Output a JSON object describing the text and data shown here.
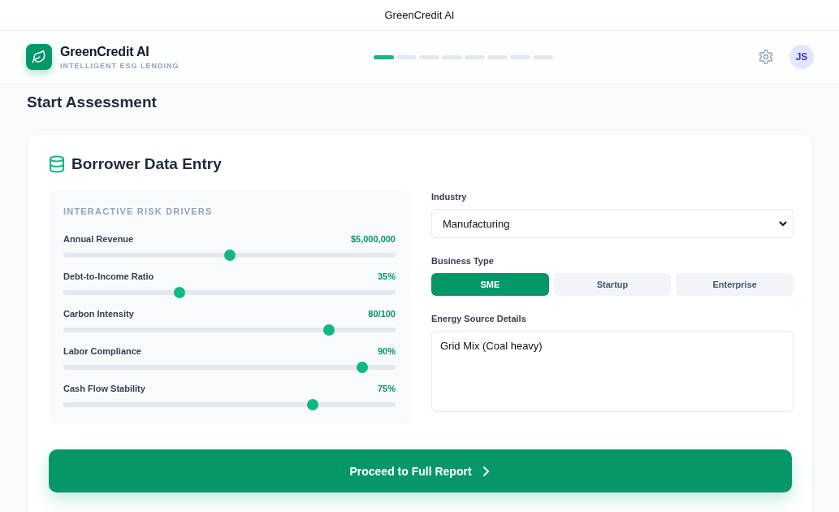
{
  "window": {
    "title": "GreenCredit AI"
  },
  "header": {
    "app_name": "GreenCredit AI",
    "tagline": "INTELLIGENT ESG LENDING",
    "progress": [
      {
        "done": true
      },
      {
        "done": false
      },
      {
        "done": false
      },
      {
        "done": false
      },
      {
        "done": false
      },
      {
        "done": false
      },
      {
        "done": false
      },
      {
        "done": false
      }
    ],
    "avatar": "JS"
  },
  "page": {
    "title": "Start Assessment"
  },
  "card": {
    "title": "Borrower Data Entry",
    "drivers": {
      "heading": "INTERACTIVE RISK DRIVERS",
      "sliders": [
        {
          "label": "Annual Revenue",
          "reading": "$5,000,000",
          "level": 0.5
        },
        {
          "label": "Debt-to-Income Ratio",
          "reading": "35%",
          "level": 0.35
        },
        {
          "label": "Carbon Intensity",
          "reading": "80/100",
          "level": 0.8
        },
        {
          "label": "Labor Compliance",
          "reading": "90%",
          "level": 0.9
        },
        {
          "label": "Cash Flow Stability",
          "reading": "75%",
          "level": 0.75
        }
      ]
    },
    "industry": {
      "label": "Industry",
      "value": "Manufacturing"
    },
    "business_type": {
      "label": "Business Type",
      "options": [
        {
          "label": "SME",
          "selected": true
        },
        {
          "label": "Startup",
          "selected": false
        },
        {
          "label": "Enterprise",
          "selected": false
        }
      ]
    },
    "energy": {
      "label": "Energy Source Details",
      "value": "Grid Mix (Coal heavy)"
    },
    "proceed_button": "Proceed to Full Report"
  }
}
